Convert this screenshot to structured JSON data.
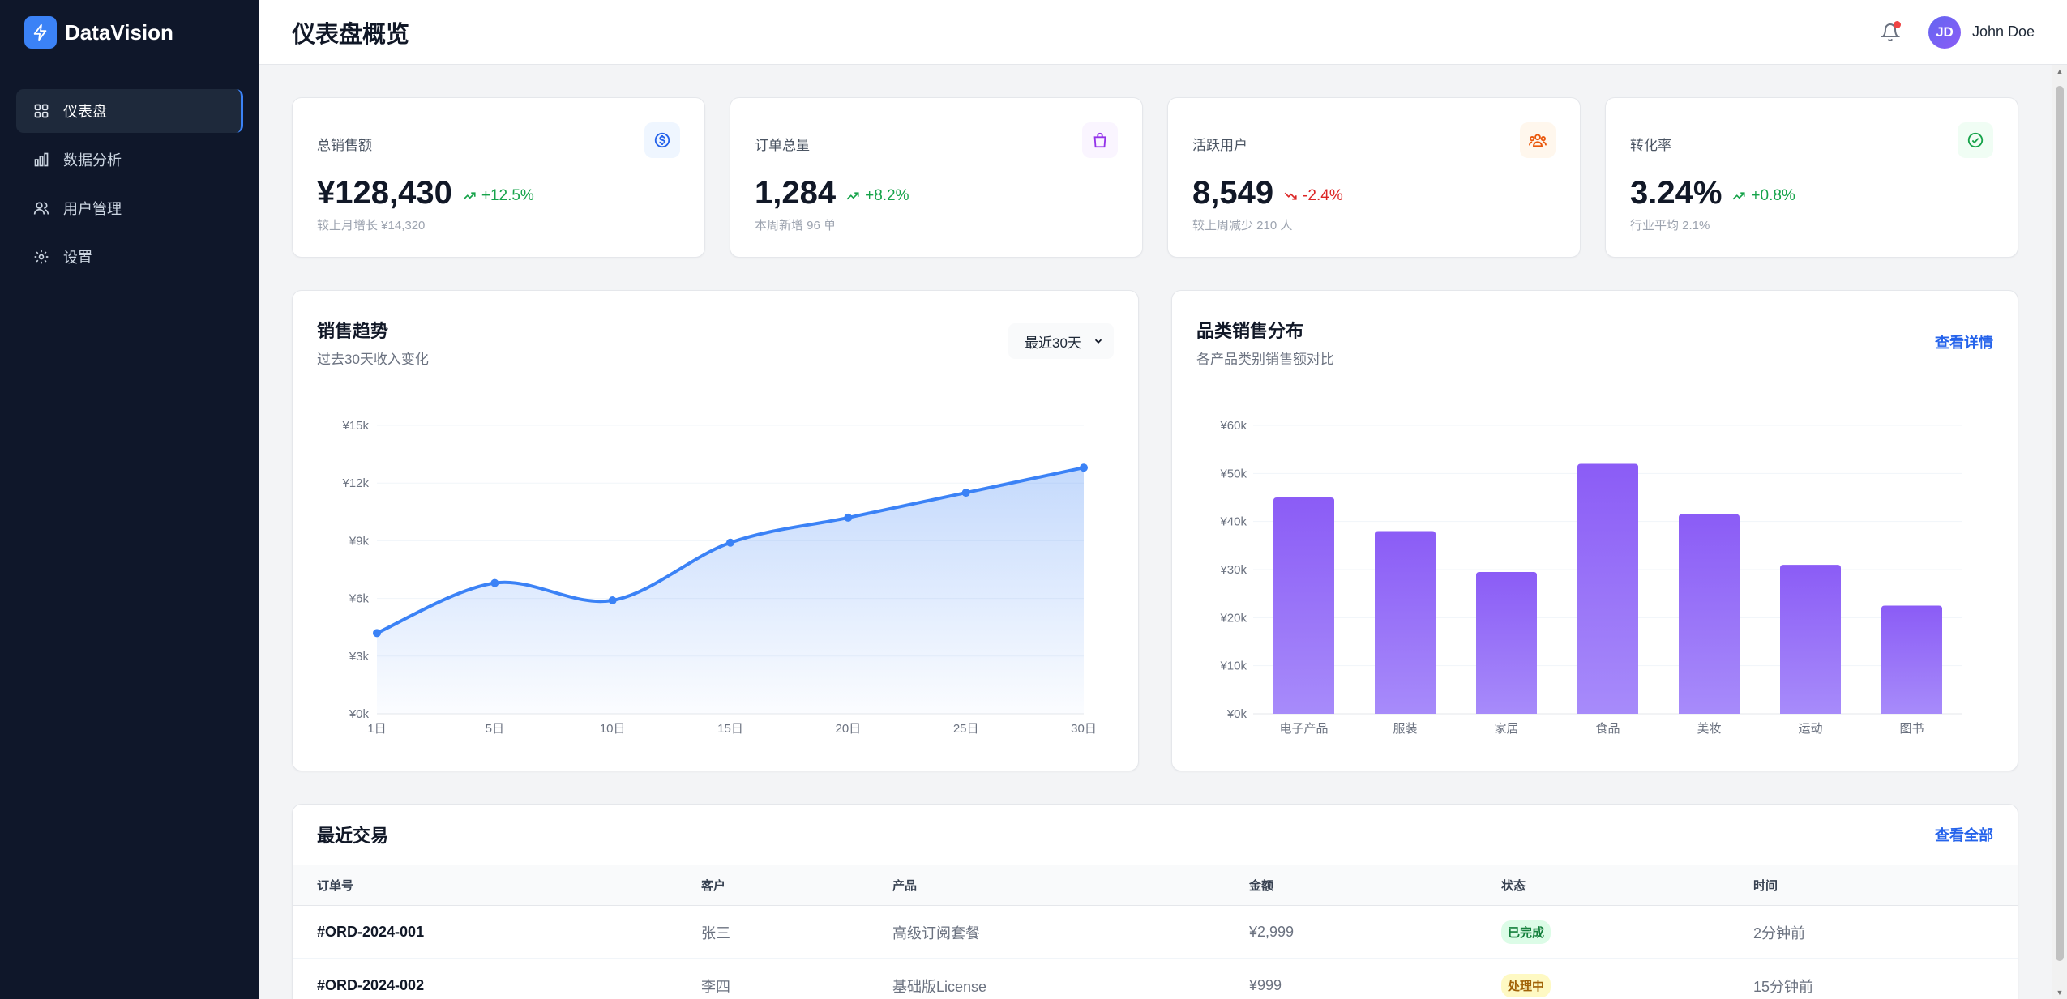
{
  "brand": {
    "name": "DataVision"
  },
  "sidebar": {
    "items": [
      {
        "label": "仪表盘",
        "icon": "grid-icon",
        "active": true
      },
      {
        "label": "数据分析",
        "icon": "bar-chart-icon",
        "active": false
      },
      {
        "label": "用户管理",
        "icon": "users-icon",
        "active": false
      },
      {
        "label": "设置",
        "icon": "gear-icon",
        "active": false
      }
    ]
  },
  "header": {
    "title": "仪表盘概览",
    "user": {
      "initials": "JD",
      "name": "John Doe"
    }
  },
  "stats": [
    {
      "label": "总销售额",
      "value": "¥128,430",
      "change": "+12.5%",
      "trend": "up",
      "sub": "较上月增长 ¥14,320",
      "icon": "dollar-icon",
      "icon_color": "#2563eb",
      "icon_bg": "#eff6ff"
    },
    {
      "label": "订单总量",
      "value": "1,284",
      "change": "+8.2%",
      "trend": "up",
      "sub": "本周新增 96 单",
      "icon": "shopping-bag-icon",
      "icon_color": "#9333ea",
      "icon_bg": "#faf5ff"
    },
    {
      "label": "活跃用户",
      "value": "8,549",
      "change": "-2.4%",
      "trend": "down",
      "sub": "较上周减少 210 人",
      "icon": "users-icon",
      "icon_color": "#ea580c",
      "icon_bg": "#fff7ed"
    },
    {
      "label": "转化率",
      "value": "3.24%",
      "change": "+0.8%",
      "trend": "up",
      "sub": "行业平均 2.1%",
      "icon": "check-circle-icon",
      "icon_color": "#16a34a",
      "icon_bg": "#f0fdf4"
    }
  ],
  "sales_chart": {
    "title": "销售趋势",
    "subtitle": "过去30天收入变化",
    "range_label": "最近30天"
  },
  "category_chart": {
    "title": "品类销售分布",
    "subtitle": "各产品类别销售额对比",
    "link": "查看详情"
  },
  "chart_data": [
    {
      "type": "area",
      "title": "销售趋势",
      "subtitle": "过去30天收入变化",
      "categories": [
        "1日",
        "5日",
        "10日",
        "15日",
        "20日",
        "25日",
        "30日"
      ],
      "values": [
        4200,
        6800,
        5900,
        8900,
        10200,
        11500,
        12800
      ],
      "y_ticks": [
        "¥0k",
        "¥3k",
        "¥6k",
        "¥9k",
        "¥12k",
        "¥15k"
      ],
      "ylim": [
        0,
        15000
      ],
      "color": "#3b82f6",
      "grid": true
    },
    {
      "type": "bar",
      "title": "品类销售分布",
      "subtitle": "各产品类别销售额对比",
      "categories": [
        "电子产品",
        "服装",
        "家居",
        "食品",
        "美妆",
        "运动",
        "图书"
      ],
      "values": [
        45000,
        38000,
        29500,
        52000,
        41500,
        31000,
        22500
      ],
      "y_ticks": [
        "¥0k",
        "¥10k",
        "¥20k",
        "¥30k",
        "¥40k",
        "¥50k",
        "¥60k"
      ],
      "ylim": [
        0,
        60000
      ],
      "color": "#8b5cf6",
      "grid": true
    }
  ],
  "transactions": {
    "title": "最近交易",
    "link": "查看全部",
    "columns": [
      "订单号",
      "客户",
      "产品",
      "金额",
      "状态",
      "时间"
    ],
    "rows": [
      {
        "order": "#ORD-2024-001",
        "customer": "张三",
        "product": "高级订阅套餐",
        "amount": "¥2,999",
        "status": "已完成",
        "status_color": "#15803d",
        "status_bg": "#dcfce7",
        "time": "2分钟前"
      },
      {
        "order": "#ORD-2024-002",
        "customer": "李四",
        "product": "基础版License",
        "amount": "¥999",
        "status": "处理中",
        "status_color": "#a16207",
        "status_bg": "#fef9c3",
        "time": "15分钟前"
      }
    ]
  }
}
